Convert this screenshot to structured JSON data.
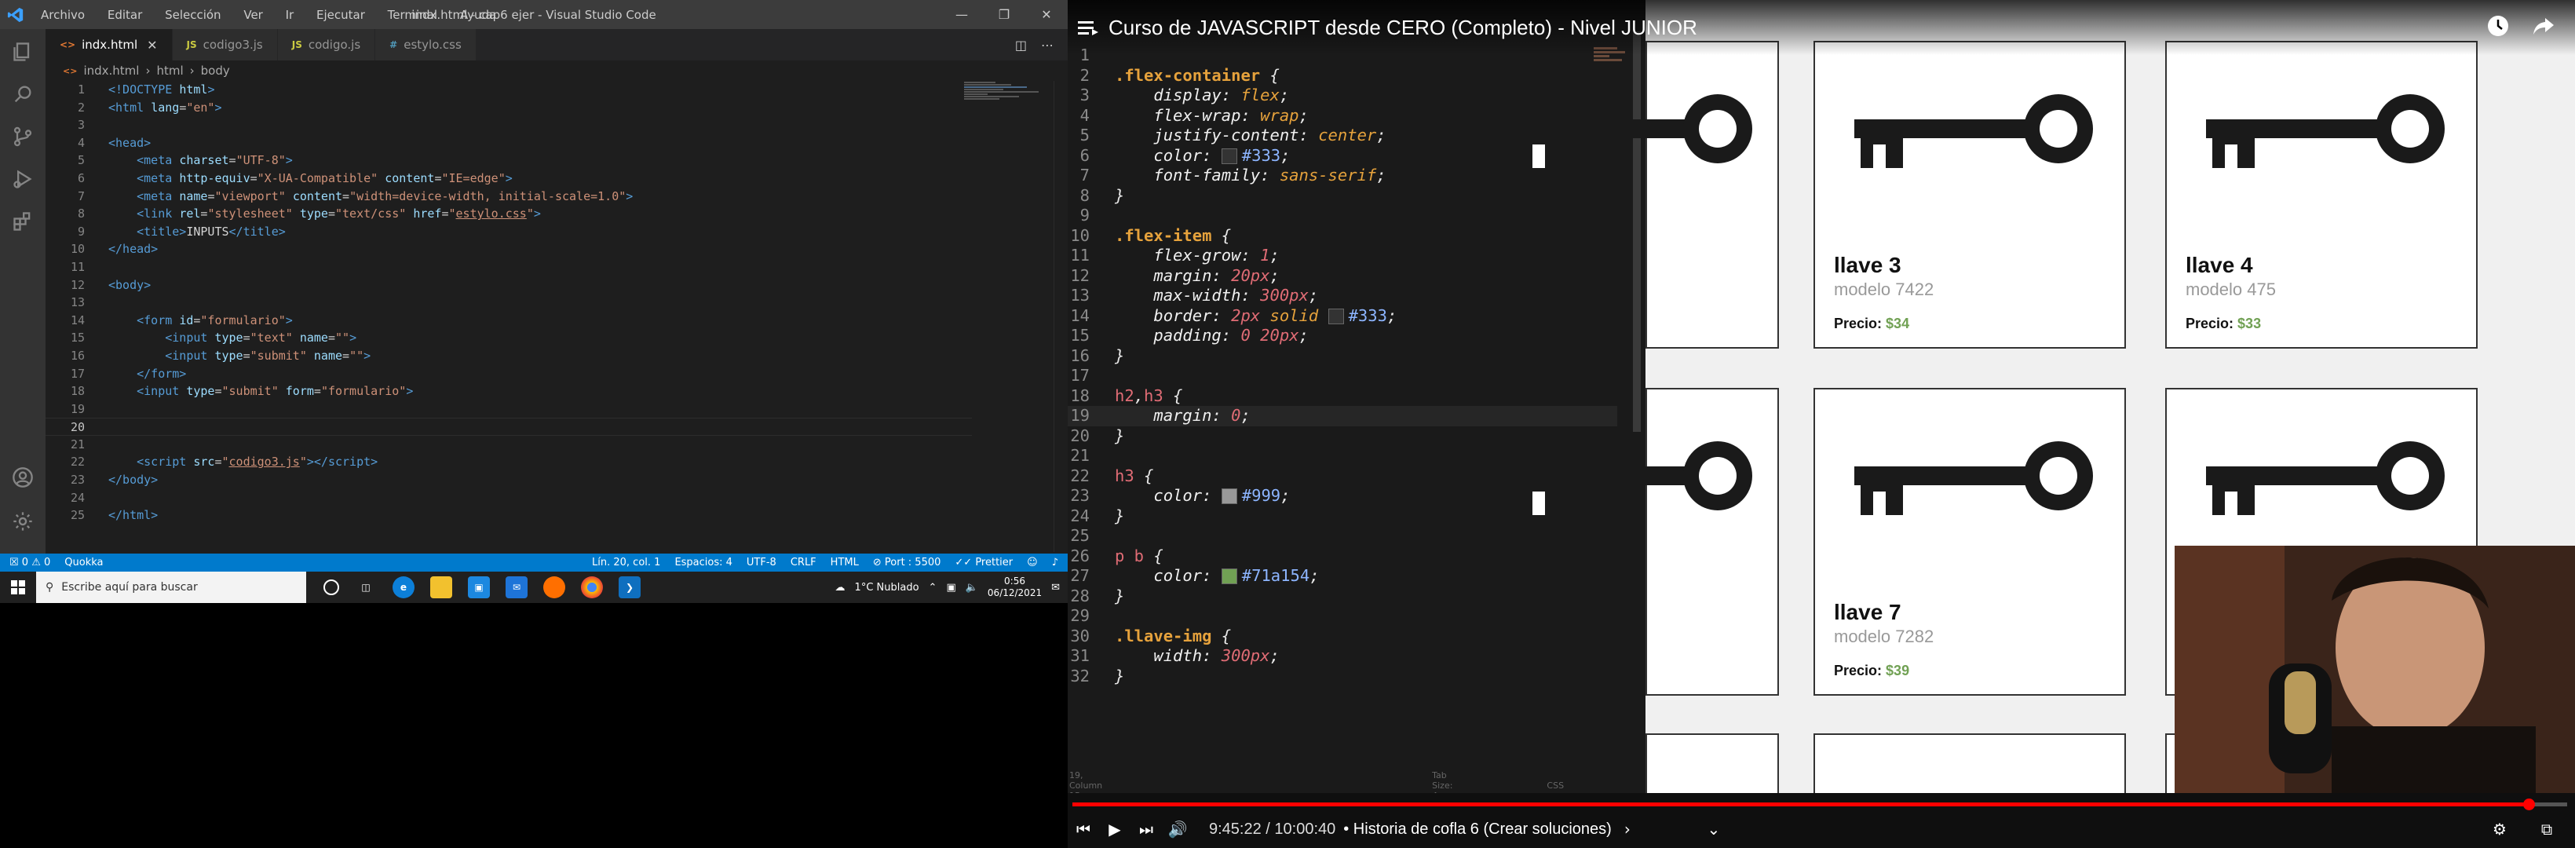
{
  "vscode": {
    "menu": [
      "Archivo",
      "Editar",
      "Selección",
      "Ver",
      "Ir",
      "Ejecutar",
      "Terminal",
      "Ayuda"
    ],
    "window_title": "indx.html - cap6 ejer - Visual Studio Code",
    "tabs": [
      {
        "label": "indx.html",
        "type": "html",
        "icon_text": "<>",
        "active": true
      },
      {
        "label": "codigo3.js",
        "type": "js",
        "icon_text": "JS",
        "active": false
      },
      {
        "label": "codigo.js",
        "type": "js",
        "icon_text": "JS",
        "active": false
      },
      {
        "label": "estylo.css",
        "type": "css",
        "icon_text": "#",
        "active": false
      }
    ],
    "breadcrumb": [
      "indx.html",
      "html",
      "body"
    ],
    "current_line": 20,
    "code_lines": [
      "1",
      "2",
      "3",
      "4",
      "5",
      "6",
      "7",
      "8",
      "9",
      "10",
      "11",
      "12",
      "13",
      "14",
      "15",
      "16",
      "17",
      "18",
      "19",
      "20",
      "21",
      "22",
      "23",
      "24",
      "25"
    ],
    "status": {
      "errors": "0",
      "warnings": "0",
      "quokka": "Quokka",
      "position": "Lín. 20, col. 1",
      "spaces": "Espacios: 4",
      "encoding": "UTF-8",
      "eol": "CRLF",
      "language": "HTML",
      "port": "Port : 5500",
      "prettier": "Prettier"
    }
  },
  "taskbar": {
    "search_placeholder": "Escribe aquí para buscar",
    "weather": "1°C  Nublado",
    "time": "0:56",
    "date": "06/12/2021"
  },
  "video": {
    "title": "Curso de JAVASCRIPT desde CERO (Completo) - Nivel JUNIOR",
    "time": "9:45:22 / 10:00:40",
    "chapter": "• Historia de cofla 6 (Crear soluciones)",
    "progress": 0.9745,
    "editor_status": {
      "position": "19, Column 15",
      "tab_size": "Tab Size: 4",
      "lang": "CSS"
    },
    "colors": {
      "c333": "#333",
      "c999": "#999",
      "green": "#71a154"
    },
    "cards": [
      {
        "name": "llave 3",
        "model": "modelo 7422",
        "price_label": "Precio:",
        "price": "$34"
      },
      {
        "name": "llave 4",
        "model": "modelo 475",
        "price_label": "Precio:",
        "price": "$33"
      },
      {
        "name": "llave 7",
        "model": "modelo 7282",
        "price_label": "Precio:",
        "price": "$39"
      }
    ]
  }
}
